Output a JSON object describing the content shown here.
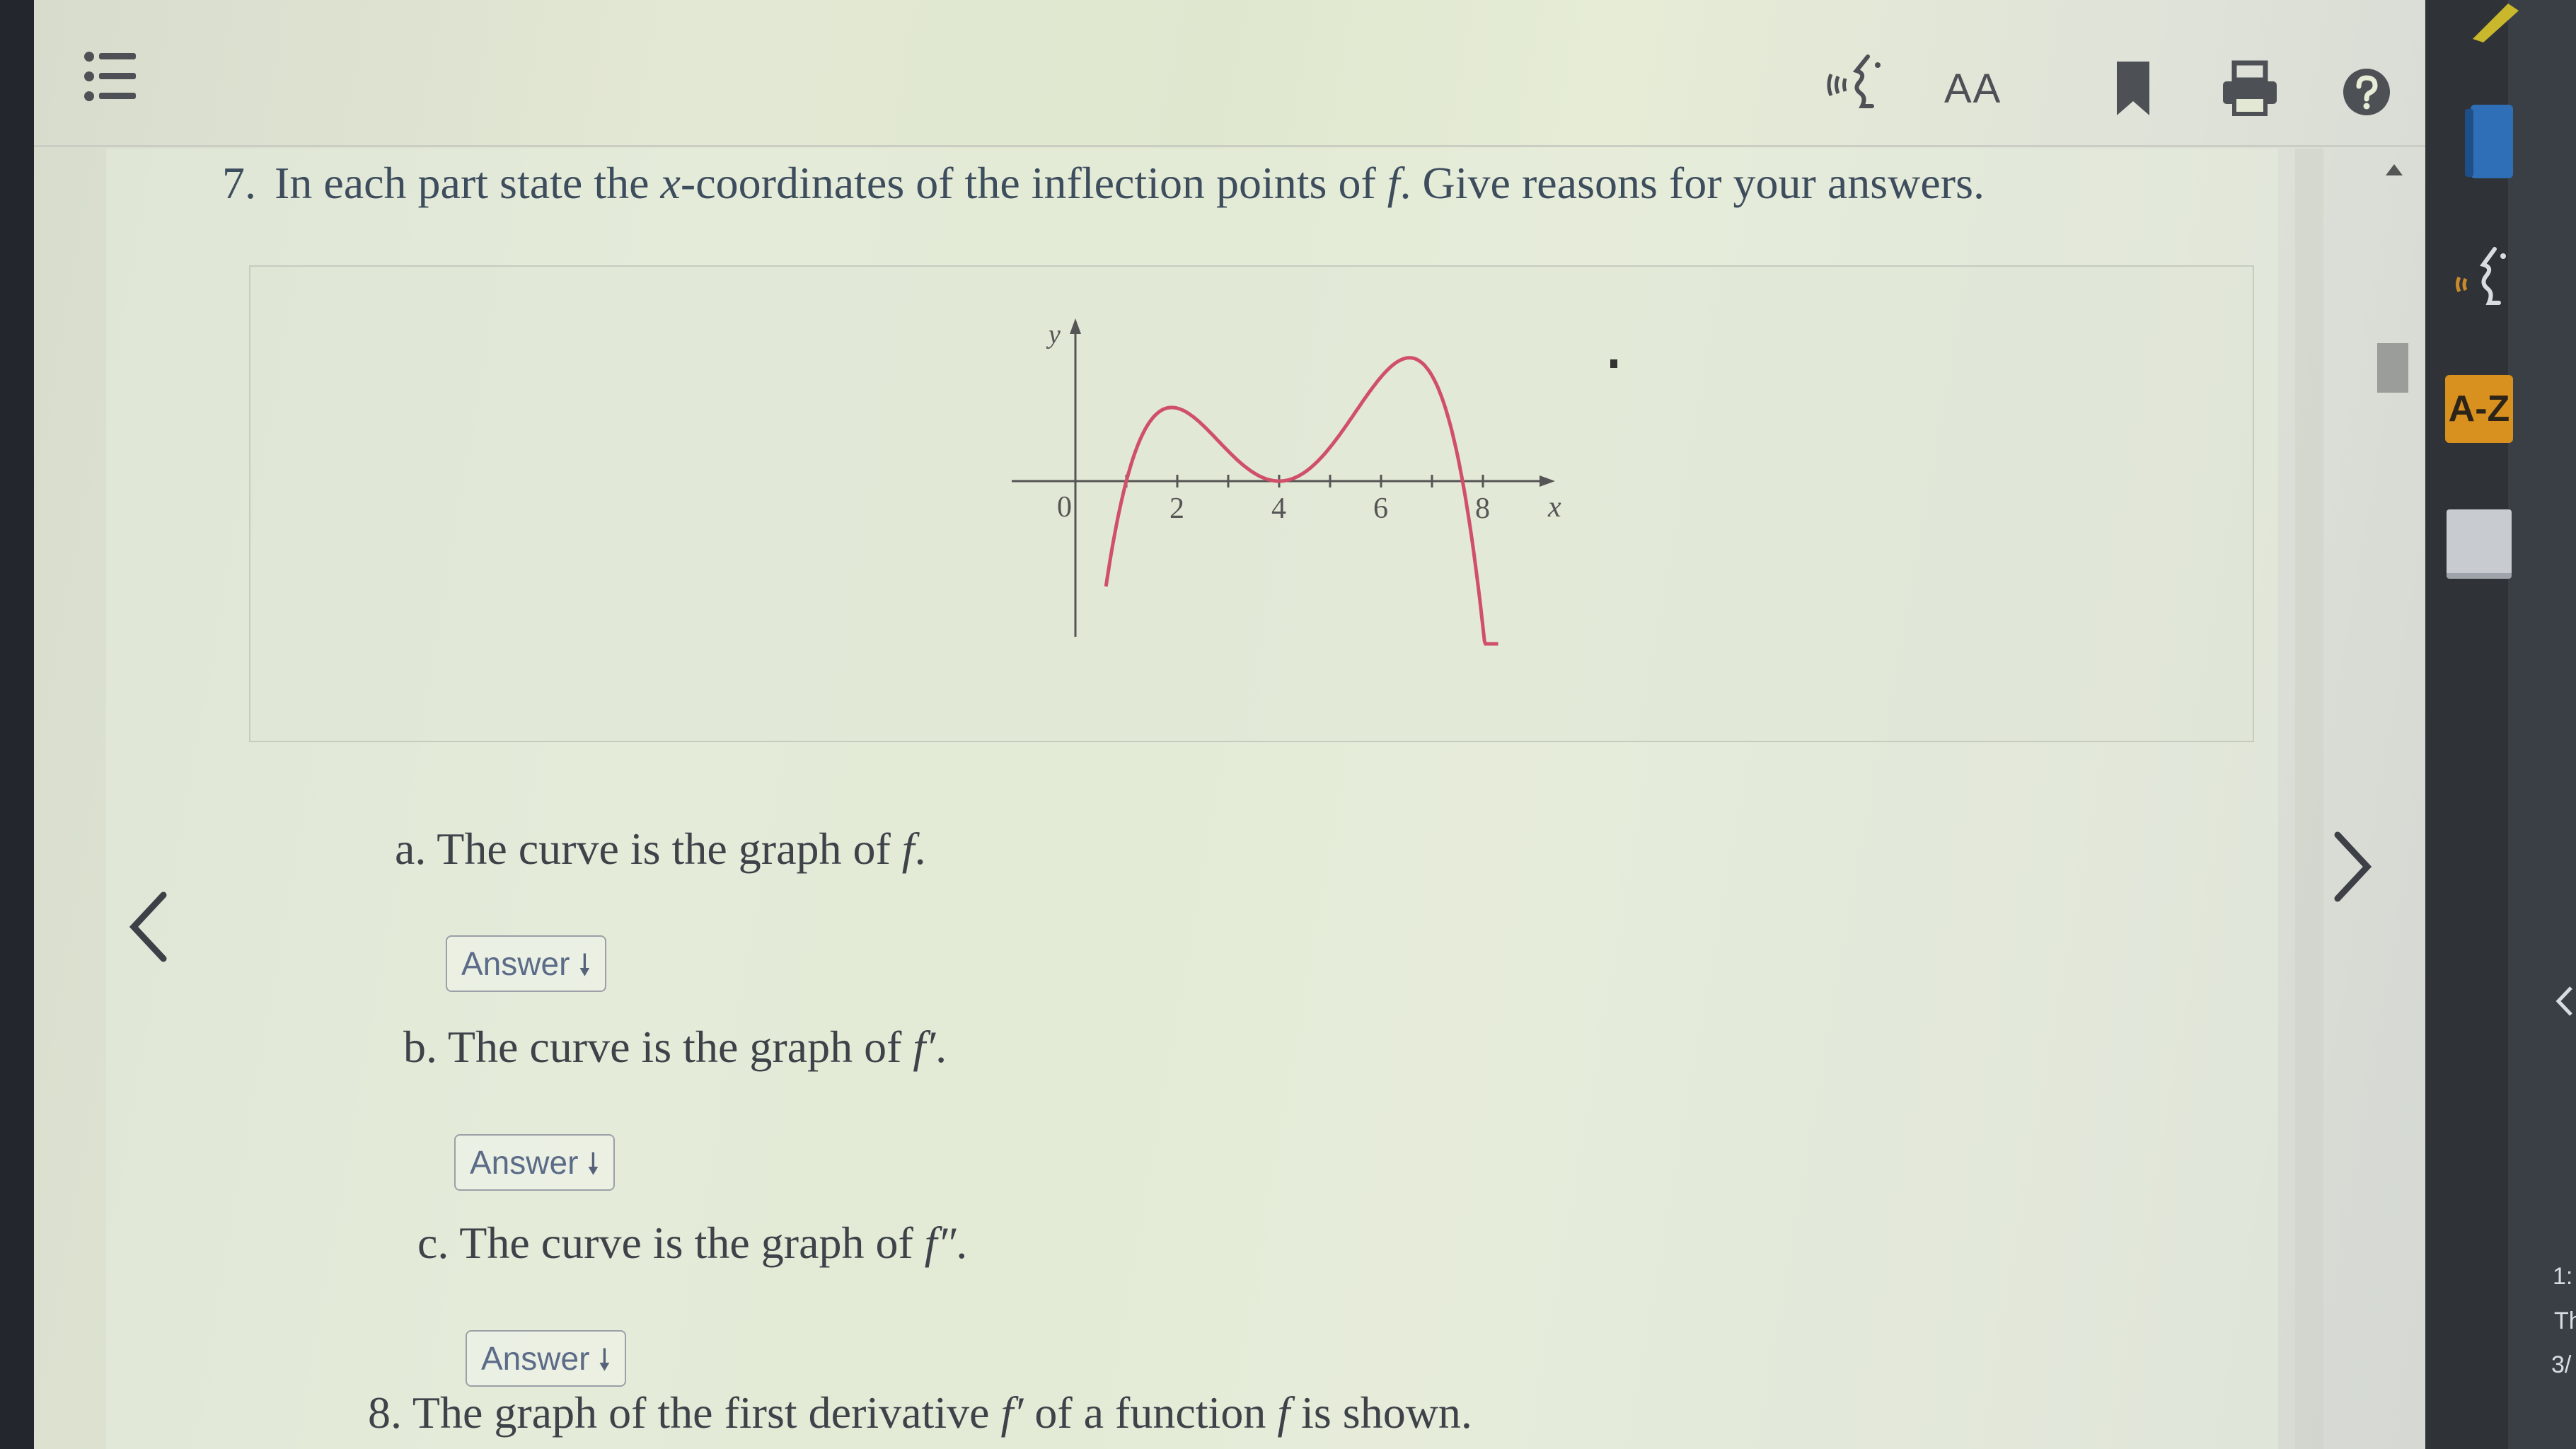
{
  "toolbar": {
    "menu_icon": "list-icon",
    "audio_icon": "text-to-speech-icon",
    "text_size_label": "AA",
    "bookmark_icon": "bookmark-icon",
    "print_icon": "print-icon",
    "help_icon": "help-icon"
  },
  "question": {
    "number": "7.",
    "text_before_var": "In each part state the ",
    "var_x": "x",
    "text_middle": "-coordinates of the inflection points of ",
    "var_f": "f",
    "text_after": ". Give reasons for your answers."
  },
  "graph": {
    "y_axis_label": "y",
    "x_axis_label": "x",
    "origin_label": "0",
    "curve_color": "#d0506a",
    "axis_color": "#555555",
    "x_ticks": [
      {
        "value": 1,
        "label": ""
      },
      {
        "value": 2,
        "label": "2"
      },
      {
        "value": 3,
        "label": ""
      },
      {
        "value": 4,
        "label": "4"
      },
      {
        "value": 5,
        "label": ""
      },
      {
        "value": 6,
        "label": "6"
      },
      {
        "value": 7,
        "label": ""
      },
      {
        "value": 8,
        "label": "8"
      }
    ]
  },
  "parts": [
    {
      "prefix": "a. The curve is the graph of ",
      "symbol": "f",
      "suffix": "."
    },
    {
      "prefix": "b. The curve is the graph of ",
      "symbol": "f′",
      "suffix": "."
    },
    {
      "prefix": "c. The curve is the graph of ",
      "symbol": "f″",
      "suffix": "."
    }
  ],
  "answer_button_label": "Answer",
  "answer_arrow": "🠗",
  "next_question_partial": {
    "prefix": "8. The graph of the first derivative ",
    "symbol1": "f′",
    "middle": " of a function ",
    "symbol2": "f",
    "suffix": " is shown."
  },
  "nav": {
    "prev_icon": "chevron-left-icon",
    "next_icon": "chevron-right-icon"
  },
  "side_panel": {
    "az_label": "A-Z",
    "edge_text_1": "1:",
    "edge_text_2": "Th",
    "edge_text_3": "3/"
  }
}
